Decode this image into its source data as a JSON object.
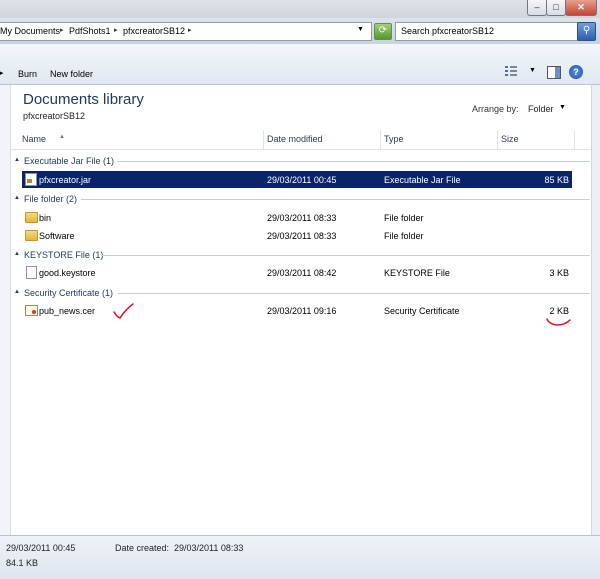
{
  "window": {
    "minimize": "–",
    "maximize": "□",
    "close": "✕"
  },
  "address": {
    "crumbs": [
      "My Documents",
      "PdfShots1",
      "pfxcreatorSB12"
    ],
    "search_placeholder": "Search pfxcreatorSB12"
  },
  "toolbar": {
    "burn": "Burn",
    "new_folder": "New folder"
  },
  "library": {
    "title": "Documents library",
    "subtitle": "pfxcreatorSB12",
    "arrange_label": "Arrange by:",
    "arrange_value": "Folder"
  },
  "columns": {
    "name": "Name",
    "date_modified": "Date modified",
    "type": "Type",
    "size": "Size"
  },
  "groups": [
    {
      "label": "Executable Jar File (1)",
      "items": [
        {
          "name": "pfxcreator.jar",
          "date": "29/03/2011 00:45",
          "type": "Executable Jar File",
          "size": "85 KB",
          "icon": "jar-file-icon",
          "selected": true
        }
      ]
    },
    {
      "label": "File folder (2)",
      "items": [
        {
          "name": "bin",
          "date": "29/03/2011 08:33",
          "type": "File folder",
          "size": "",
          "icon": "folder-icon"
        },
        {
          "name": "Software",
          "date": "29/03/2011 08:33",
          "type": "File folder",
          "size": "",
          "icon": "folder-icon"
        }
      ]
    },
    {
      "label": "KEYSTORE File (1)",
      "items": [
        {
          "name": "good.keystore",
          "date": "29/03/2011 08:42",
          "type": "KEYSTORE File",
          "size": "3 KB",
          "icon": "document-icon"
        }
      ]
    },
    {
      "label": "Security Certificate (1)",
      "items": [
        {
          "name": "pub_news.cer",
          "date": "29/03/2011 09:16",
          "type": "Security Certificate",
          "size": "2 KB",
          "icon": "certificate-icon"
        }
      ]
    }
  ],
  "details": {
    "modified": "29/03/2011 00:45",
    "created_label": "Date created:",
    "created_value": "29/03/2011 08:33",
    "size": "84.1 KB"
  },
  "colors": {
    "selection": "#0a246a",
    "annotation": "#e0101e",
    "title": "#1e395b"
  }
}
